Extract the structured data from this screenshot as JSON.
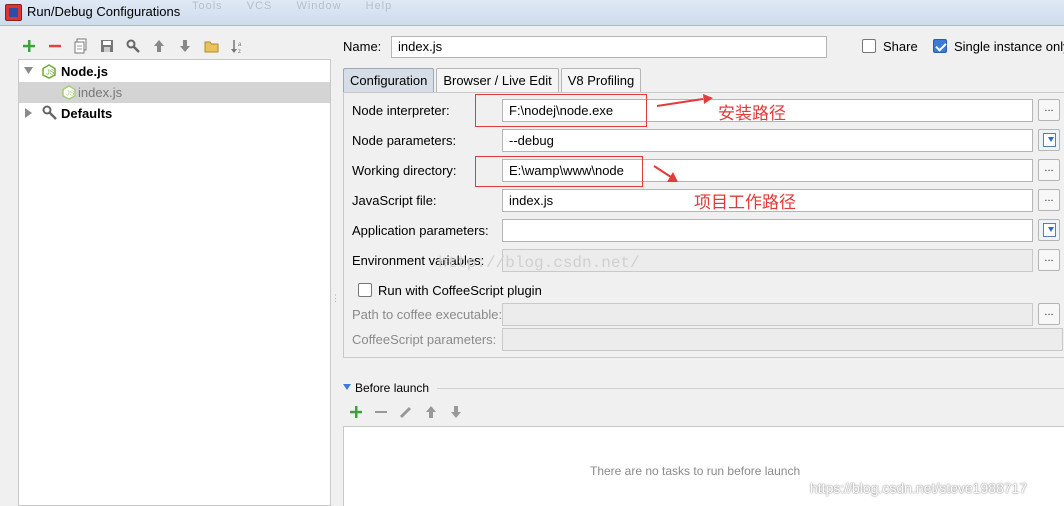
{
  "window": {
    "title": "Run/Debug Configurations",
    "ghost_menu": [
      "Tools",
      "VCS",
      "Window",
      "Help"
    ]
  },
  "toolbar": {
    "icons": [
      "add-icon",
      "remove-icon",
      "copy-icon",
      "save-icon",
      "wrench-icon",
      "move-up-icon",
      "move-down-icon",
      "folder-icon",
      "sort-icon"
    ]
  },
  "tree": {
    "items": [
      {
        "label": "Node.js",
        "icon": "nodejs-icon",
        "expanded": true
      },
      {
        "label": "index.js",
        "icon": "nodejs-icon",
        "selected": true
      },
      {
        "label": "Defaults",
        "icon": "wrench-icon",
        "expanded": false
      }
    ]
  },
  "header": {
    "name_label": "Name:",
    "name_value": "index.js",
    "share_label": "Share",
    "share_checked": false,
    "single_instance_label": "Single instance only",
    "single_instance_checked": true
  },
  "tabs": [
    {
      "label": "Configuration",
      "active": true
    },
    {
      "label": "Browser / Live Edit",
      "active": false
    },
    {
      "label": "V8 Profiling",
      "active": false
    }
  ],
  "config": {
    "node_interpreter": {
      "label": "Node interpreter:",
      "value": "F:\\nodej\\node.exe"
    },
    "node_parameters": {
      "label": "Node parameters:",
      "value": "--debug"
    },
    "working_directory": {
      "label": "Working directory:",
      "value": "E:\\wamp\\www\\node"
    },
    "javascript_file": {
      "label": "JavaScript file:",
      "value": "index.js"
    },
    "application_parameters": {
      "label": "Application parameters:",
      "value": ""
    },
    "environment_variables": {
      "label": "Environment variables:",
      "value": ""
    },
    "coffee_checkbox": {
      "label": "Run with CoffeeScript plugin",
      "checked": false
    },
    "coffee_path": {
      "label": "Path to coffee executable:",
      "value": ""
    },
    "coffee_params": {
      "label": "CoffeeScript parameters:",
      "value": ""
    },
    "browse_label": "..."
  },
  "annotations": {
    "install_path": "安装路径",
    "project_path": "项目工作路径",
    "color": "#e23b3b"
  },
  "watermark": "http://blog.csdn.net/",
  "before_launch": {
    "label": "Before launch",
    "empty_text": "There are no tasks to run before launch"
  },
  "footer_watermark": "https://blog.csdn.net/steve1988717"
}
